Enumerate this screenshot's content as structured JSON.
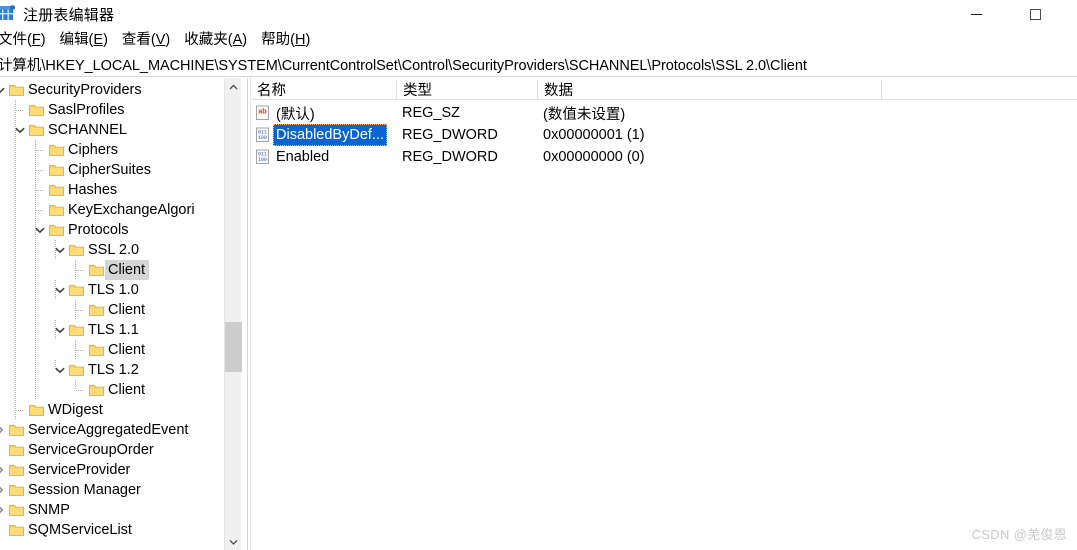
{
  "window": {
    "title": "注册表编辑器",
    "icon": "regedit-icon",
    "minimize_label": "最小化",
    "maximize_label": "最大化"
  },
  "menu": {
    "items": [
      {
        "label": "文件(F)",
        "text": "文件",
        "accel": "F"
      },
      {
        "label": "编辑(E)",
        "text": "编辑",
        "accel": "E"
      },
      {
        "label": "查看(V)",
        "text": "查看",
        "accel": "V"
      },
      {
        "label": "收藏夹(A)",
        "text": "收藏夹",
        "accel": "A"
      },
      {
        "label": "帮助(H)",
        "text": "帮助",
        "accel": "H"
      }
    ]
  },
  "address": {
    "path": "计算机\\HKEY_LOCAL_MACHINE\\SYSTEM\\CurrentControlSet\\Control\\SecurityProviders\\SCHANNEL\\Protocols\\SSL 2.0\\Client"
  },
  "tree": {
    "nodes": [
      {
        "label": "SecurityProviders",
        "depth": 1,
        "state": "expanded",
        "selected": false
      },
      {
        "label": "SaslProfiles",
        "depth": 2,
        "state": "leaf",
        "selected": false
      },
      {
        "label": "SCHANNEL",
        "depth": 2,
        "state": "expanded",
        "selected": false
      },
      {
        "label": "Ciphers",
        "depth": 3,
        "state": "leaf",
        "selected": false
      },
      {
        "label": "CipherSuites",
        "depth": 3,
        "state": "leaf",
        "selected": false
      },
      {
        "label": "Hashes",
        "depth": 3,
        "state": "leaf",
        "selected": false
      },
      {
        "label": "KeyExchangeAlgori",
        "depth": 3,
        "state": "leaf",
        "selected": false
      },
      {
        "label": "Protocols",
        "depth": 3,
        "state": "expanded",
        "selected": false
      },
      {
        "label": "SSL 2.0",
        "depth": 4,
        "state": "expanded",
        "selected": false
      },
      {
        "label": "Client",
        "depth": 5,
        "state": "leaf",
        "selected": true
      },
      {
        "label": "TLS 1.0",
        "depth": 4,
        "state": "expanded",
        "selected": false
      },
      {
        "label": "Client",
        "depth": 5,
        "state": "leaf",
        "selected": false
      },
      {
        "label": "TLS 1.1",
        "depth": 4,
        "state": "expanded",
        "selected": false
      },
      {
        "label": "Client",
        "depth": 5,
        "state": "leaf",
        "selected": false
      },
      {
        "label": "TLS 1.2",
        "depth": 4,
        "state": "expanded",
        "selected": false
      },
      {
        "label": "Client",
        "depth": 5,
        "state": "leaf",
        "selected": false
      },
      {
        "label": "WDigest",
        "depth": 2,
        "state": "leaf",
        "selected": false
      },
      {
        "label": "ServiceAggregatedEvent",
        "depth": 1,
        "state": "collapsed",
        "selected": false
      },
      {
        "label": "ServiceGroupOrder",
        "depth": 1,
        "state": "leaf",
        "selected": false
      },
      {
        "label": "ServiceProvider",
        "depth": 1,
        "state": "collapsed",
        "selected": false
      },
      {
        "label": "Session Manager",
        "depth": 1,
        "state": "collapsed",
        "selected": false
      },
      {
        "label": "SNMP",
        "depth": 1,
        "state": "collapsed",
        "selected": false
      },
      {
        "label": "SQMServiceList",
        "depth": 1,
        "state": "leaf",
        "selected": false
      }
    ],
    "scrollbar": {
      "up_icon": "chevron-up-icon",
      "down_icon": "chevron-down-icon"
    }
  },
  "list": {
    "columns": [
      {
        "label": "名称"
      },
      {
        "label": "类型"
      },
      {
        "label": "数据"
      }
    ],
    "rows": [
      {
        "name": "(默认)",
        "type": "REG_SZ",
        "data": "(数值未设置)",
        "icon": "string-value-icon",
        "selected": false
      },
      {
        "name": "DisabledByDef...",
        "type": "REG_DWORD",
        "data": "0x00000001 (1)",
        "icon": "dword-value-icon",
        "selected": true
      },
      {
        "name": "Enabled",
        "type": "REG_DWORD",
        "data": "0x00000000 (0)",
        "icon": "dword-value-icon",
        "selected": false
      }
    ]
  },
  "watermark": {
    "text": "CSDN @羌俊恩"
  },
  "colors": {
    "selection_blue": "#0a64d2",
    "selection_gray": "#d5d5d5",
    "folder_yellow": "#ffd04d",
    "scroll_thumb": "#cdcdcd"
  }
}
